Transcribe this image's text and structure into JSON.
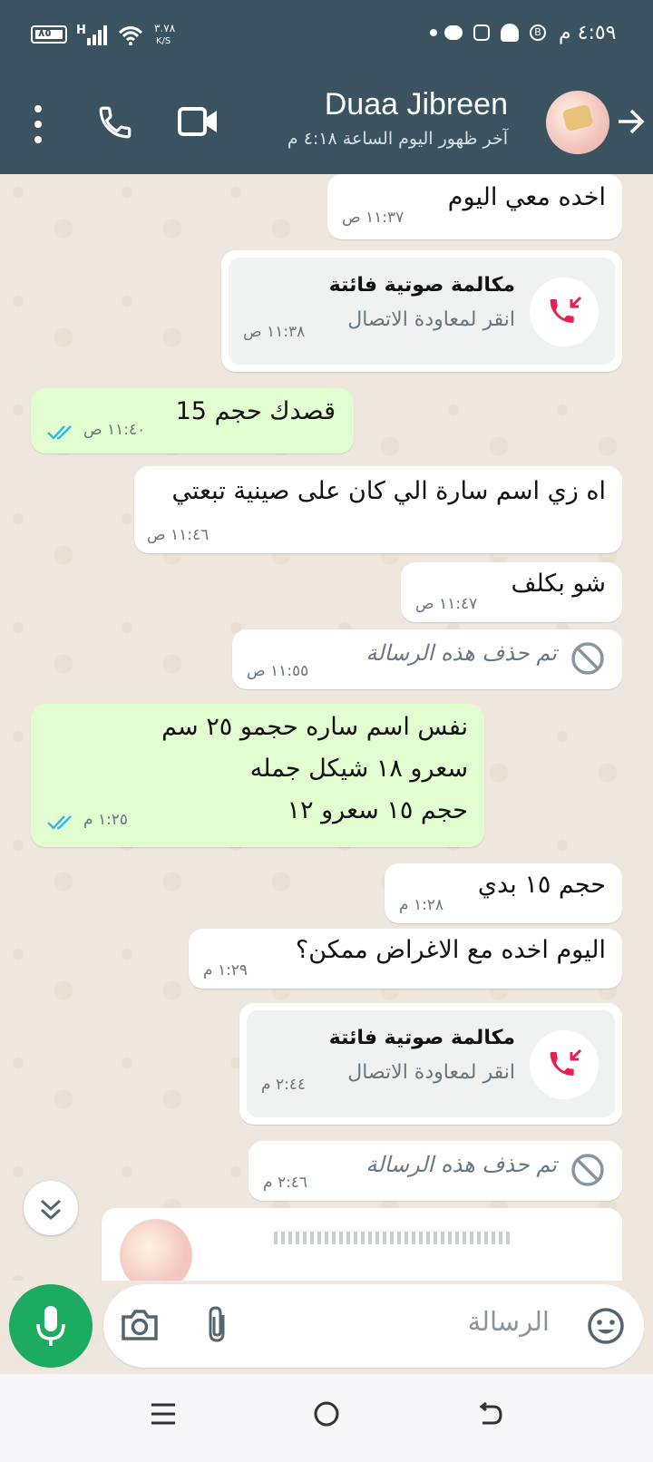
{
  "status_bar": {
    "time": "٤:٥٩ م",
    "battery": "٨٥",
    "network": "H",
    "speed_value": "٣.٧٨",
    "speed_unit": "K/S"
  },
  "header": {
    "contact_name": "Duaa Jibreen",
    "last_seen": "آخر ظهور اليوم الساعة ٤:١٨ م"
  },
  "messages": [
    {
      "text": "اخده معي اليوم",
      "time": "١١:٣٧ ص"
    },
    {
      "call_title": "مكالمة صوتية فائتة",
      "call_sub": "انقر لمعاودة الاتصال",
      "time": "١١:٣٨ ص"
    },
    {
      "text": "قصدك حجم 15",
      "time": "١١:٤٠ ص"
    },
    {
      "text": "اه زي اسم سارة الي كان على صينية تبعتي",
      "time": "١١:٤٦ ص"
    },
    {
      "text": "شو بكلف",
      "time": "١١:٤٧ ص"
    },
    {
      "text": "تم حذف هذه الرسالة",
      "time": "١١:٥٥ ص"
    },
    {
      "line1": "نفس اسم ساره حجمو ٢٥ سم",
      "line2": "سعرو ١٨ شيكل جمله",
      "line3": "حجم ١٥ سعرو ١٢",
      "time": "١:٢٥ م"
    },
    {
      "text": "حجم ١٥ بدي",
      "time": "١:٢٨ م"
    },
    {
      "text": "اليوم اخده مع الاغراض ممكن؟",
      "time": "١:٢٩ م"
    },
    {
      "call_title": "مكالمة صوتية فائتة",
      "call_sub": "انقر لمعاودة الاتصال",
      "time": "٢:٤٤ م"
    },
    {
      "text": "تم حذف هذه الرسالة",
      "time": "٢:٤٦ م"
    }
  ],
  "composer": {
    "placeholder": "الرسالة"
  },
  "colors": {
    "header_bg": "#3b5360",
    "outgoing_bubble": "#e2fdd0",
    "incoming_bubble": "#ffffff",
    "accent_green": "#1daa61",
    "missed_call_red": "#e9204f",
    "read_tick_blue": "#34b7f1"
  }
}
